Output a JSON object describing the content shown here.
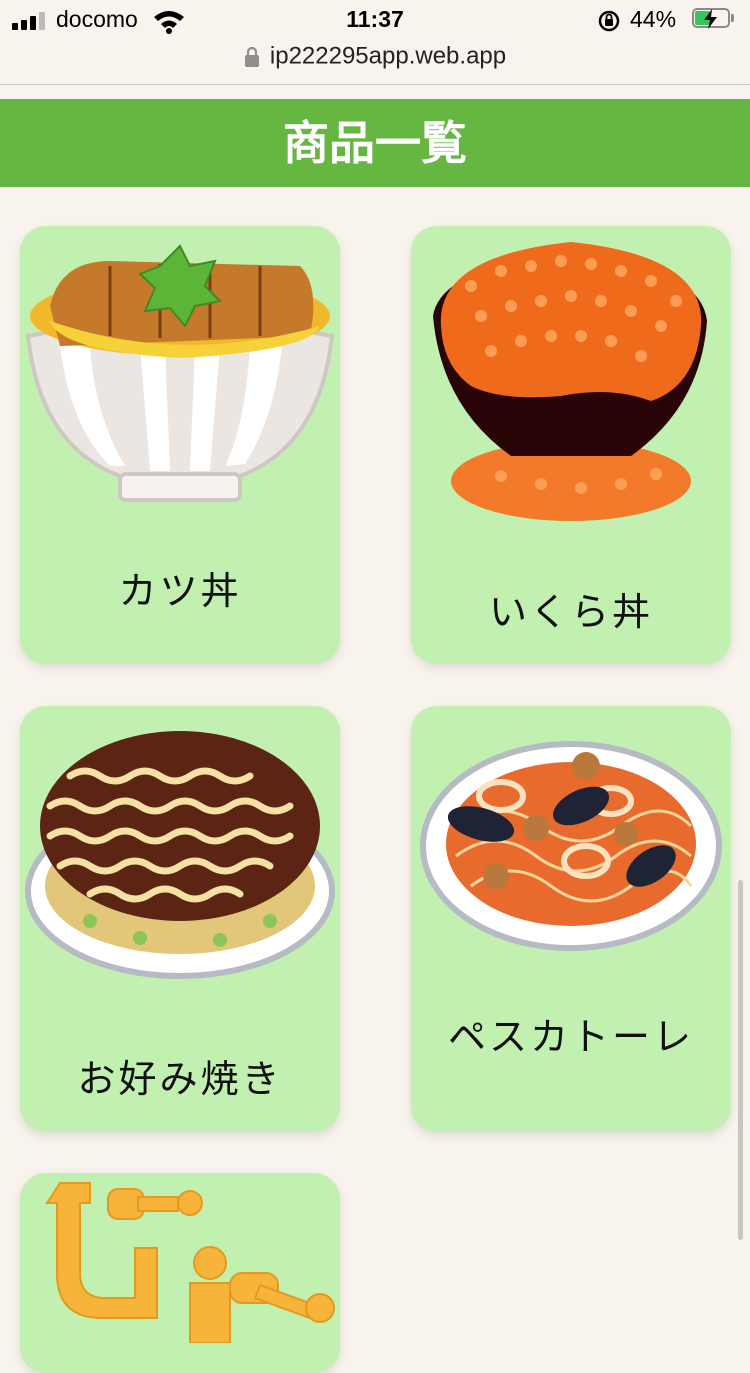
{
  "status_bar": {
    "carrier": "docomo",
    "time": "11:37",
    "battery": "44%"
  },
  "browser": {
    "url": "ip222295app.web.app"
  },
  "header": {
    "title": "商品一覧"
  },
  "products": [
    {
      "name": "カツ丼"
    },
    {
      "name": "いくら丼"
    },
    {
      "name": "お好み焼き"
    },
    {
      "name": "ペスカトーレ"
    },
    {
      "name": ""
    }
  ],
  "colors": {
    "header": "#65b741",
    "card": "#c2f0b0",
    "background": "#f8f3ec"
  }
}
